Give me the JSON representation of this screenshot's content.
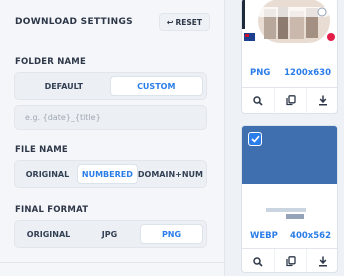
{
  "settings": {
    "title": "DOWNLOAD SETTINGS",
    "reset_label": "RESET",
    "folder_name": {
      "label": "FOLDER NAME",
      "options": [
        "DEFAULT",
        "CUSTOM"
      ],
      "selected": "CUSTOM",
      "input_value": "",
      "input_placeholder": "e.g. {date}_{title}"
    },
    "file_name": {
      "label": "FILE NAME",
      "options": [
        "ORIGINAL",
        "NUMBERED",
        "DOMAIN+NUM"
      ],
      "selected": "NUMBERED"
    },
    "final_format": {
      "label": "FINAL FORMAT",
      "options": [
        "ORIGINAL",
        "JPG",
        "PNG"
      ],
      "selected": "PNG"
    }
  },
  "gallery": {
    "images": [
      {
        "format": "PNG",
        "dimensions": "1200x630",
        "selected": false
      },
      {
        "format": "WEBP",
        "dimensions": "400x562",
        "selected": true
      }
    ],
    "actions": [
      "search-icon",
      "copy-icon",
      "download-icon"
    ]
  },
  "colors": {
    "accent": "#2b7de9",
    "panel_bg": "#f4f6f9",
    "card_blue": "#3f6fae"
  }
}
